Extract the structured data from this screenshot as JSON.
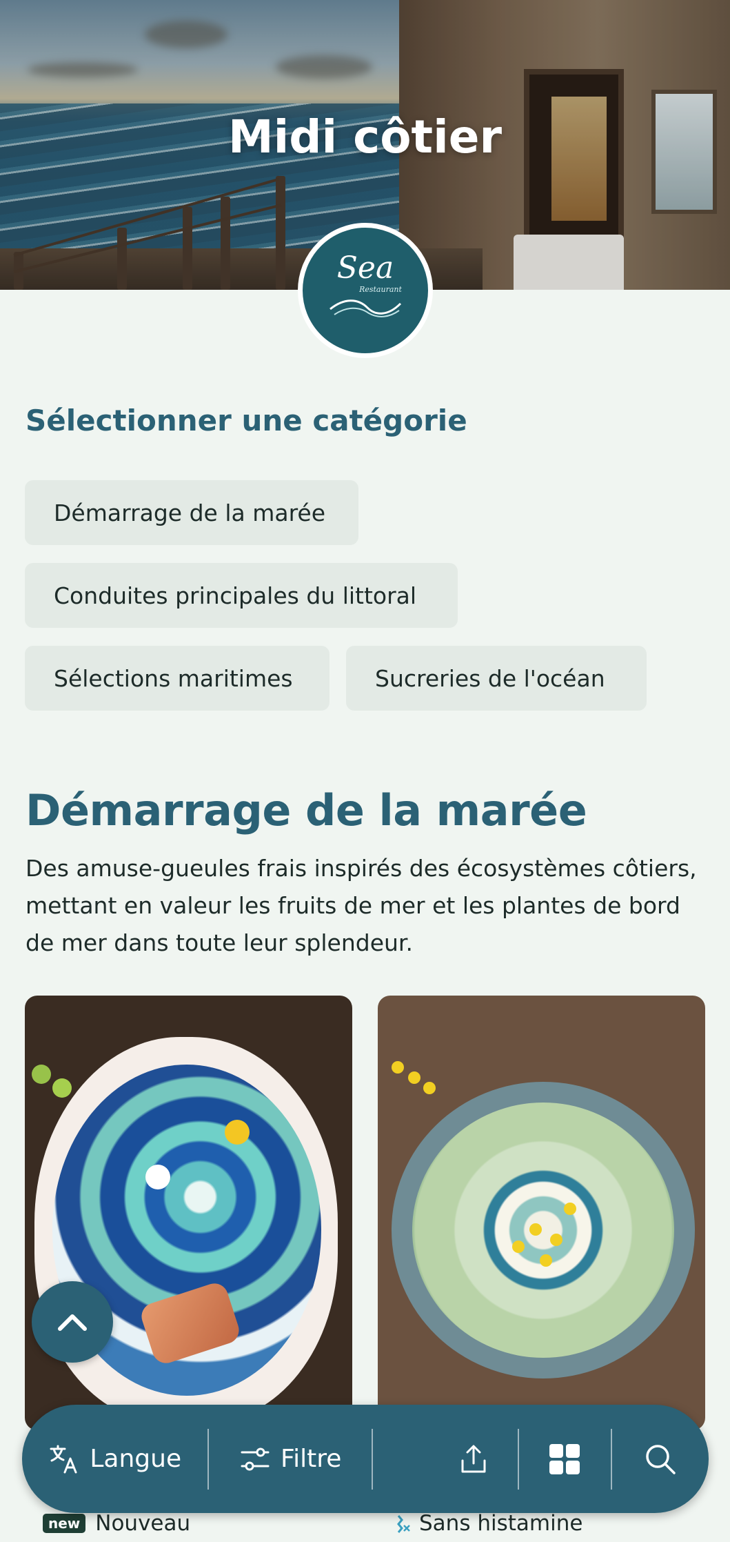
{
  "hero": {
    "title": "Midi côtier",
    "logo": {
      "word": "Sea",
      "sub": "Restaurant"
    }
  },
  "categories": {
    "heading": "Sélectionner une catégorie",
    "chips": [
      {
        "label": "Démarrage de la marée"
      },
      {
        "label": "Conduites principales du littoral"
      },
      {
        "label": "Sélections maritimes"
      },
      {
        "label": "Sucreries de l'océan"
      }
    ]
  },
  "section": {
    "title": "Démarrage de la marée",
    "description": "Des amuse-gueules frais inspirés des écosystèmes côtiers, mettant en valeur les fruits de mer et les plantes de bord de mer dans toute leur splendeur."
  },
  "dishes": [
    {
      "tag": "new",
      "tag_label": "Nouveau",
      "icon": "new-badge"
    },
    {
      "tag_label": "Sans histamine",
      "icon": "histamine-free-icon"
    }
  ],
  "toolbar": {
    "language_label": "Langue",
    "filter_label": "Filtre",
    "icons": [
      "translate-icon",
      "filter-icon",
      "share-icon",
      "grid-icon",
      "search-icon"
    ]
  },
  "colors": {
    "accent": "#2b6175",
    "background": "#f0f5f1",
    "chip": "#e3eae5"
  }
}
